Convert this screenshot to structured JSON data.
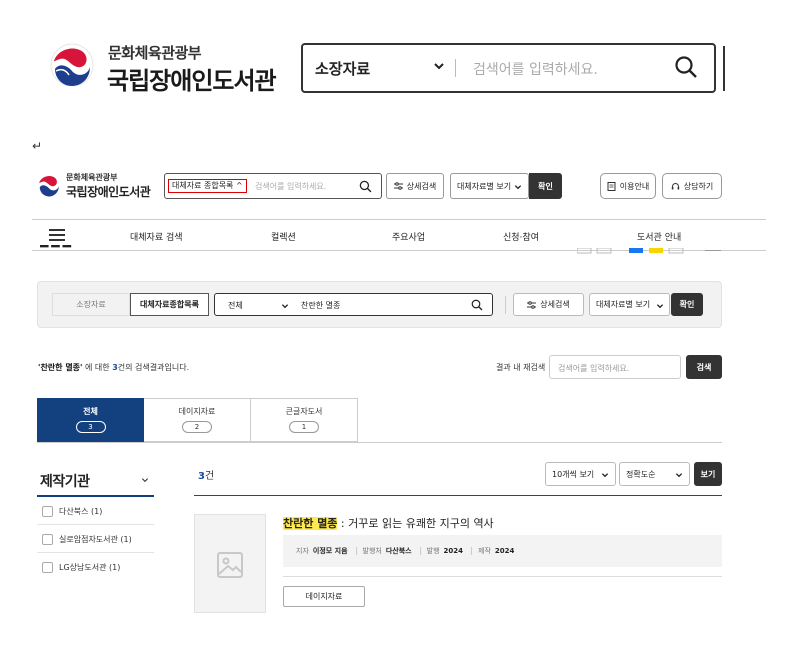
{
  "header_large": {
    "org": "문화체육관광부",
    "library": "국립장애인도서관",
    "search_select": "소장자료",
    "search_placeholder": "검색어를 입력하세요."
  },
  "return_mark": "↵",
  "header_small": {
    "org": "문화체육관광부",
    "library": "국립장애인도서관",
    "search_select": "대체자료 종합목록 ^",
    "search_placeholder": "검색어를 입력하세요.",
    "detail_search": "상세검색",
    "view_by_type": "대체자료별 보기",
    "confirm": "확인",
    "usage_guide": "이용안내",
    "consult": "상담하기"
  },
  "nav": {
    "items": [
      "대체자료 검색",
      "컬렉션",
      "주요사업",
      "신청·참여",
      "도서관 안내"
    ]
  },
  "search_panel": {
    "tab_holdings": "소장자료",
    "tab_union": "대체자료종합목록",
    "select": "전체",
    "query": "찬란한 멸종",
    "detail_search": "상세검색",
    "view_by_type": "대체자료별 보기",
    "confirm": "확인"
  },
  "result_summary": {
    "query": "'찬란한 멸종'",
    "mid": " 에 대한 ",
    "count": "3",
    "suffix": "건의 검색결과입니다."
  },
  "refine": {
    "label": "결과 내 재검색",
    "placeholder": "검색어를 입력하세요.",
    "button": "검색"
  },
  "result_tabs": [
    {
      "label": "전체",
      "count": "3"
    },
    {
      "label": "데이지자료",
      "count": "2"
    },
    {
      "label": "큰글자도서",
      "count": "1"
    }
  ],
  "facet": {
    "title": "제작기관",
    "items": [
      {
        "label": "다산북스 (1)"
      },
      {
        "label": "실로암점자도서관 (1)"
      },
      {
        "label": "LG상남도서관 (1)"
      }
    ]
  },
  "results_header": {
    "count": "3",
    "unit": "건",
    "page_size": "10개씩 보기",
    "sort": "정확도순",
    "view_button": "보기"
  },
  "result_item": {
    "title_highlight": "찬란한 멸종",
    "title_rest": " : 거꾸로 읽는 유쾌한 지구의 역사",
    "author_label": "지자",
    "author": "이정모 지음",
    "publisher_label": "발행처",
    "publisher": "다산북스",
    "year_label": "발행",
    "year": "2024",
    "made_label": "제작",
    "made": "2024",
    "badge": "데이지자료"
  }
}
